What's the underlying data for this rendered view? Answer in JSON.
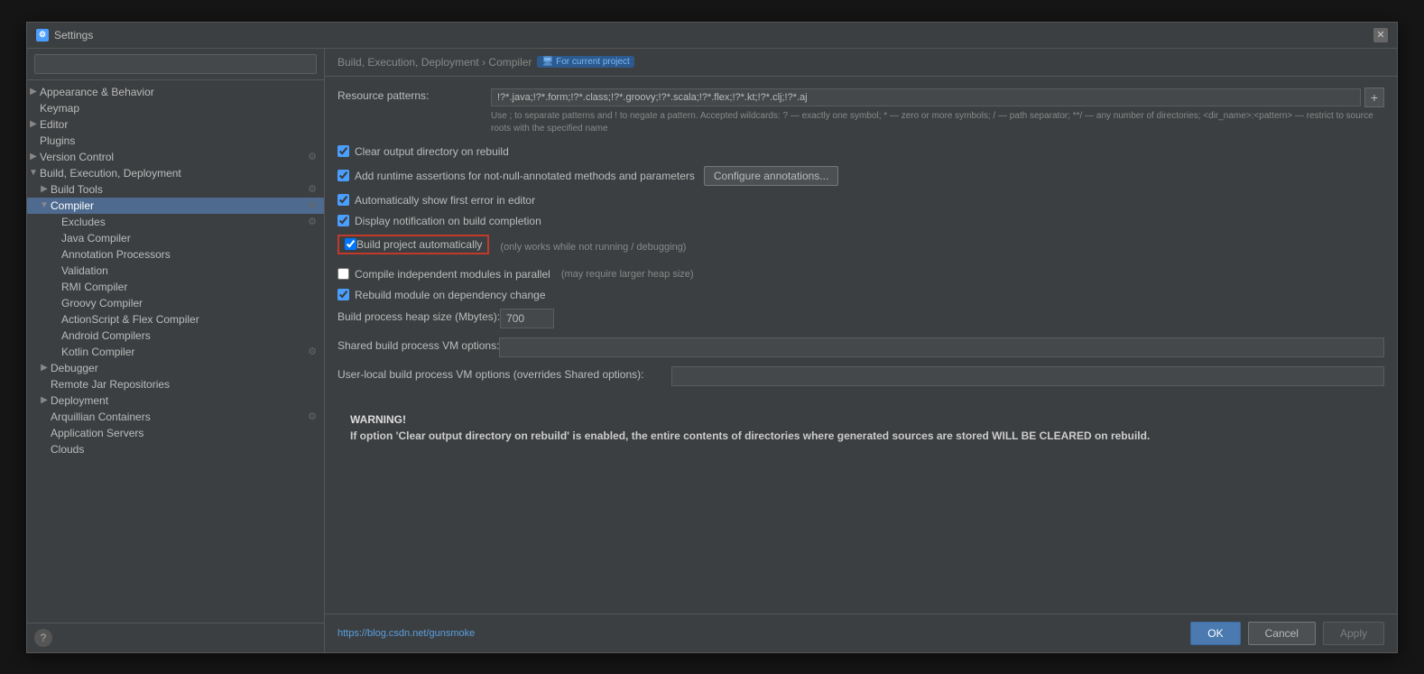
{
  "dialog": {
    "title": "Settings",
    "close_label": "✕"
  },
  "sidebar": {
    "search_placeholder": "",
    "items": [
      {
        "id": "appearance",
        "label": "Appearance & Behavior",
        "level": 0,
        "arrow": "▶",
        "has_gear": false,
        "selected": false
      },
      {
        "id": "keymap",
        "label": "Keymap",
        "level": 0,
        "arrow": "",
        "has_gear": false,
        "selected": false
      },
      {
        "id": "editor",
        "label": "Editor",
        "level": 0,
        "arrow": "▶",
        "has_gear": false,
        "selected": false
      },
      {
        "id": "plugins",
        "label": "Plugins",
        "level": 0,
        "arrow": "",
        "has_gear": false,
        "selected": false
      },
      {
        "id": "version-control",
        "label": "Version Control",
        "level": 0,
        "arrow": "▶",
        "has_gear": true,
        "selected": false
      },
      {
        "id": "build-execution",
        "label": "Build, Execution, Deployment",
        "level": 0,
        "arrow": "▼",
        "has_gear": false,
        "selected": false
      },
      {
        "id": "build-tools",
        "label": "Build Tools",
        "level": 1,
        "arrow": "▶",
        "has_gear": true,
        "selected": false
      },
      {
        "id": "compiler",
        "label": "Compiler",
        "level": 1,
        "arrow": "▼",
        "has_gear": true,
        "selected": true
      },
      {
        "id": "excludes",
        "label": "Excludes",
        "level": 2,
        "arrow": "",
        "has_gear": true,
        "selected": false
      },
      {
        "id": "java-compiler",
        "label": "Java Compiler",
        "level": 2,
        "arrow": "",
        "has_gear": false,
        "selected": false
      },
      {
        "id": "annotation-processors",
        "label": "Annotation Processors",
        "level": 2,
        "arrow": "",
        "has_gear": false,
        "selected": false
      },
      {
        "id": "validation",
        "label": "Validation",
        "level": 2,
        "arrow": "",
        "has_gear": false,
        "selected": false
      },
      {
        "id": "rmi-compiler",
        "label": "RMI Compiler",
        "level": 2,
        "arrow": "",
        "has_gear": false,
        "selected": false
      },
      {
        "id": "groovy-compiler",
        "label": "Groovy Compiler",
        "level": 2,
        "arrow": "",
        "has_gear": false,
        "selected": false
      },
      {
        "id": "actionscript-flex",
        "label": "ActionScript & Flex Compiler",
        "level": 2,
        "arrow": "",
        "has_gear": false,
        "selected": false
      },
      {
        "id": "android-compilers",
        "label": "Android Compilers",
        "level": 2,
        "arrow": "",
        "has_gear": false,
        "selected": false
      },
      {
        "id": "kotlin-compiler",
        "label": "Kotlin Compiler",
        "level": 2,
        "arrow": "",
        "has_gear": true,
        "selected": false
      },
      {
        "id": "debugger",
        "label": "Debugger",
        "level": 1,
        "arrow": "▶",
        "has_gear": false,
        "selected": false
      },
      {
        "id": "remote-jar",
        "label": "Remote Jar Repositories",
        "level": 1,
        "arrow": "",
        "has_gear": false,
        "selected": false
      },
      {
        "id": "deployment",
        "label": "Deployment",
        "level": 1,
        "arrow": "▶",
        "has_gear": false,
        "selected": false
      },
      {
        "id": "arquillian",
        "label": "Arquillian Containers",
        "level": 1,
        "arrow": "",
        "has_gear": true,
        "selected": false
      },
      {
        "id": "app-servers",
        "label": "Application Servers",
        "level": 1,
        "arrow": "",
        "has_gear": false,
        "selected": false
      },
      {
        "id": "clouds",
        "label": "Clouds",
        "level": 1,
        "arrow": "",
        "has_gear": false,
        "selected": false
      }
    ]
  },
  "content": {
    "breadcrumb": "Build, Execution, Deployment › Compiler",
    "for_project": "For current project",
    "resource_patterns_label": "Resource patterns:",
    "resource_patterns_value": "!?*.java;!?*.form;!?*.class;!?*.groovy;!?*.scala;!?*.flex;!?*.kt;!?*.clj;!?*.aj",
    "resource_patterns_hint": "Use ; to separate patterns and ! to negate a pattern. Accepted wildcards: ? — exactly one symbol; * — zero or more symbols; / — path separator; **/ — any number of directories; <dir_name>:<pattern> — restrict to source roots with the specified name",
    "checkboxes": [
      {
        "id": "clear-output",
        "label": "Clear output directory on rebuild",
        "checked": true,
        "hint": ""
      },
      {
        "id": "add-runtime",
        "label": "Add runtime assertions for not-null-annotated methods and parameters",
        "checked": true,
        "hint": "",
        "has_button": true,
        "button_label": "Configure annotations..."
      },
      {
        "id": "auto-show-error",
        "label": "Automatically show first error in editor",
        "checked": true,
        "hint": ""
      },
      {
        "id": "display-notification",
        "label": "Display notification on build completion",
        "checked": true,
        "hint": ""
      },
      {
        "id": "build-auto",
        "label": "Build project automatically",
        "checked": true,
        "hint": "(only works while not running / debugging)",
        "highlighted": true
      },
      {
        "id": "compile-parallel",
        "label": "Compile independent modules in parallel",
        "checked": false,
        "hint": "(may require larger heap size)"
      },
      {
        "id": "rebuild-module",
        "label": "Rebuild module on dependency change",
        "checked": true,
        "hint": ""
      }
    ],
    "heap_size_label": "Build process heap size (Mbytes):",
    "heap_size_value": "700",
    "shared_vm_label": "Shared build process VM options:",
    "shared_vm_value": "",
    "user_vm_label": "User-local build process VM options (overrides Shared options):",
    "user_vm_value": "",
    "warning_title": "WARNING!",
    "warning_text": "If option 'Clear output directory on rebuild' is enabled, the entire contents of directories where generated sources are stored WILL BE CLEARED on rebuild."
  },
  "footer": {
    "link_text": "https://blog.csdn.net/gunsmoke",
    "ok_label": "OK",
    "cancel_label": "Cancel",
    "apply_label": "Apply"
  }
}
